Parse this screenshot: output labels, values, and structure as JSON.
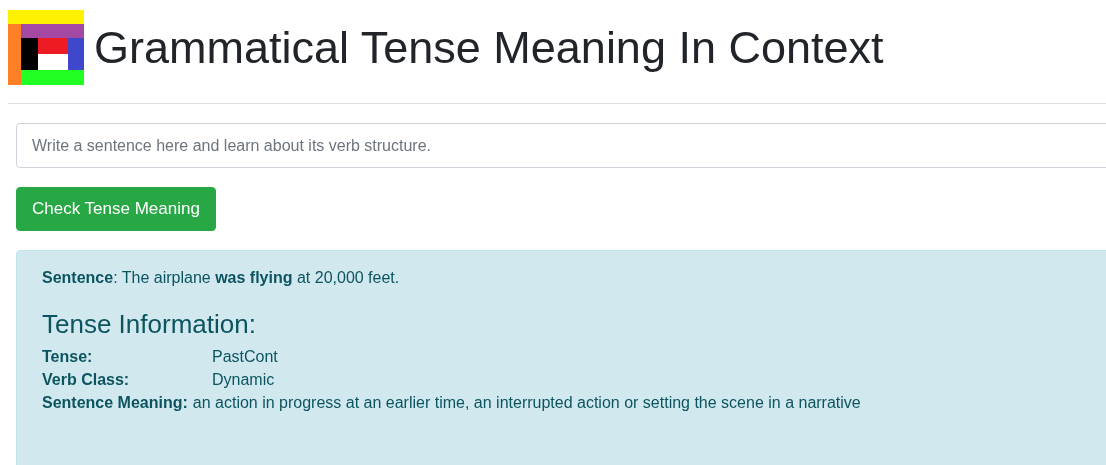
{
  "header": {
    "title": "Grammatical Tense Meaning In Context"
  },
  "input": {
    "placeholder": "Write a sentence here and learn about its verb structure."
  },
  "button": {
    "label": "Check Tense Meaning"
  },
  "result": {
    "sentence_label": "Sentence",
    "sentence": ": The airplane **was flying** at 20,000 feet.",
    "heading": "Tense Information:",
    "rows": [
      {
        "label": "Tense:",
        "value": "PastCont"
      },
      {
        "label": "Verb Class:",
        "value": "Dynamic"
      },
      {
        "label": "Sentence Meaning:",
        "value": "an action in progress at an earlier time, an interrupted action or setting the scene in a narrative"
      }
    ]
  }
}
